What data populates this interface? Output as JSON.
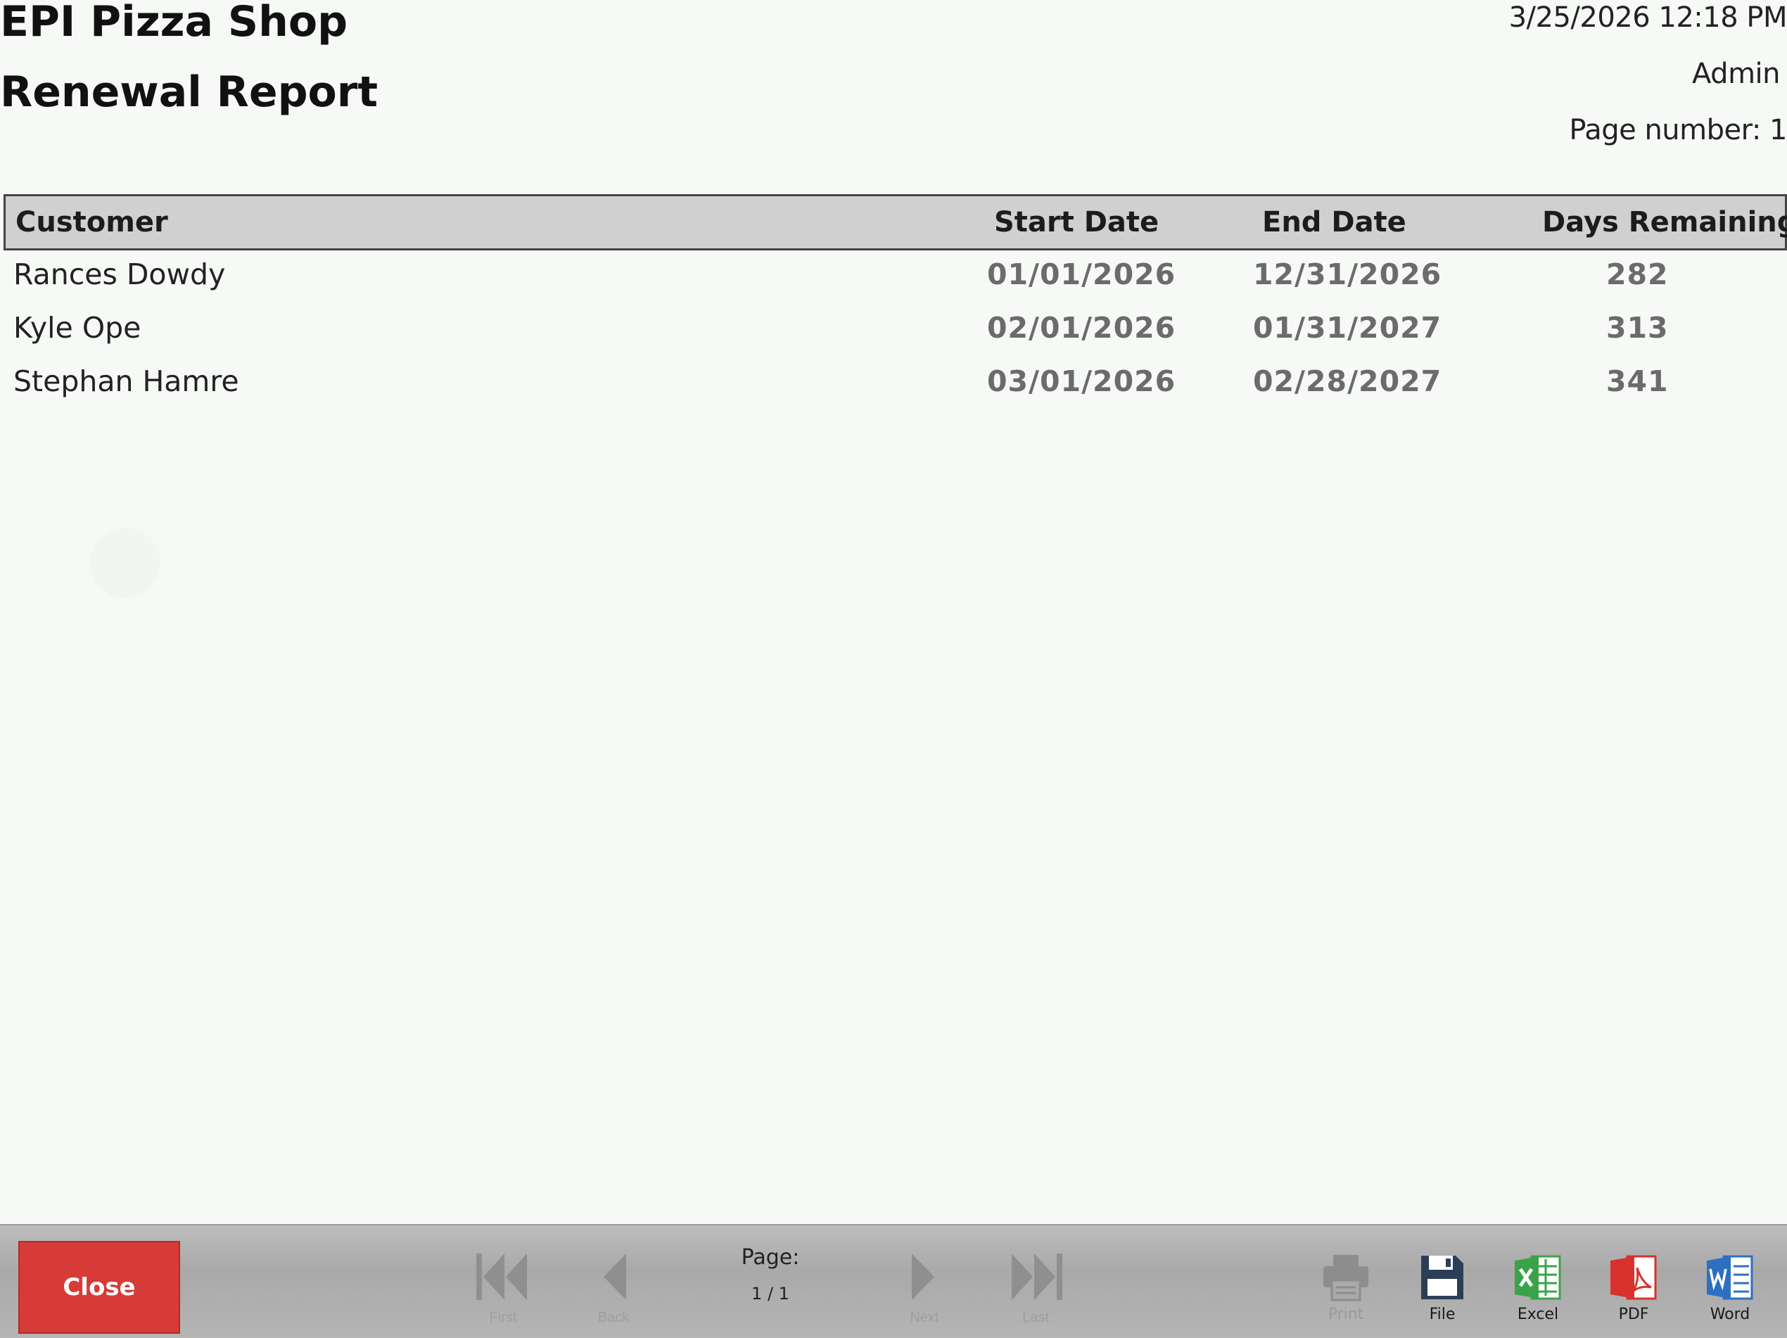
{
  "header": {
    "shop_name": "EPI Pizza Shop",
    "report_title": "Renewal Report",
    "datetime": "3/25/2026 12:18 PM",
    "user": "Admin",
    "page_number": "Page number: 1"
  },
  "table": {
    "columns": {
      "customer": "Customer",
      "start_date": "Start Date",
      "end_date": "End Date",
      "days_remaining": "Days Remaining"
    },
    "rows": [
      {
        "customer": "Rances Dowdy",
        "start_date": "01/01/2026",
        "end_date": "12/31/2026",
        "days_remaining": "282"
      },
      {
        "customer": "Kyle Ope",
        "start_date": "02/01/2026",
        "end_date": "01/31/2027",
        "days_remaining": "313"
      },
      {
        "customer": "Stephan Hamre",
        "start_date": "03/01/2026",
        "end_date": "02/28/2027",
        "days_remaining": "341"
      }
    ]
  },
  "toolbar": {
    "close_label": "Close",
    "nav": {
      "first": "First",
      "back": "Back",
      "next": "Next",
      "last": "Last"
    },
    "page_label": "Page:",
    "page_value": "1 / 1",
    "export": {
      "print": "Print",
      "file": "File",
      "excel": "Excel",
      "pdf": "PDF",
      "word": "Word"
    },
    "colors": {
      "close": "#d63b37",
      "file": "#2c3e57",
      "excel": "#3aa34a",
      "pdf": "#d9312b",
      "word": "#2f6fc1"
    }
  }
}
